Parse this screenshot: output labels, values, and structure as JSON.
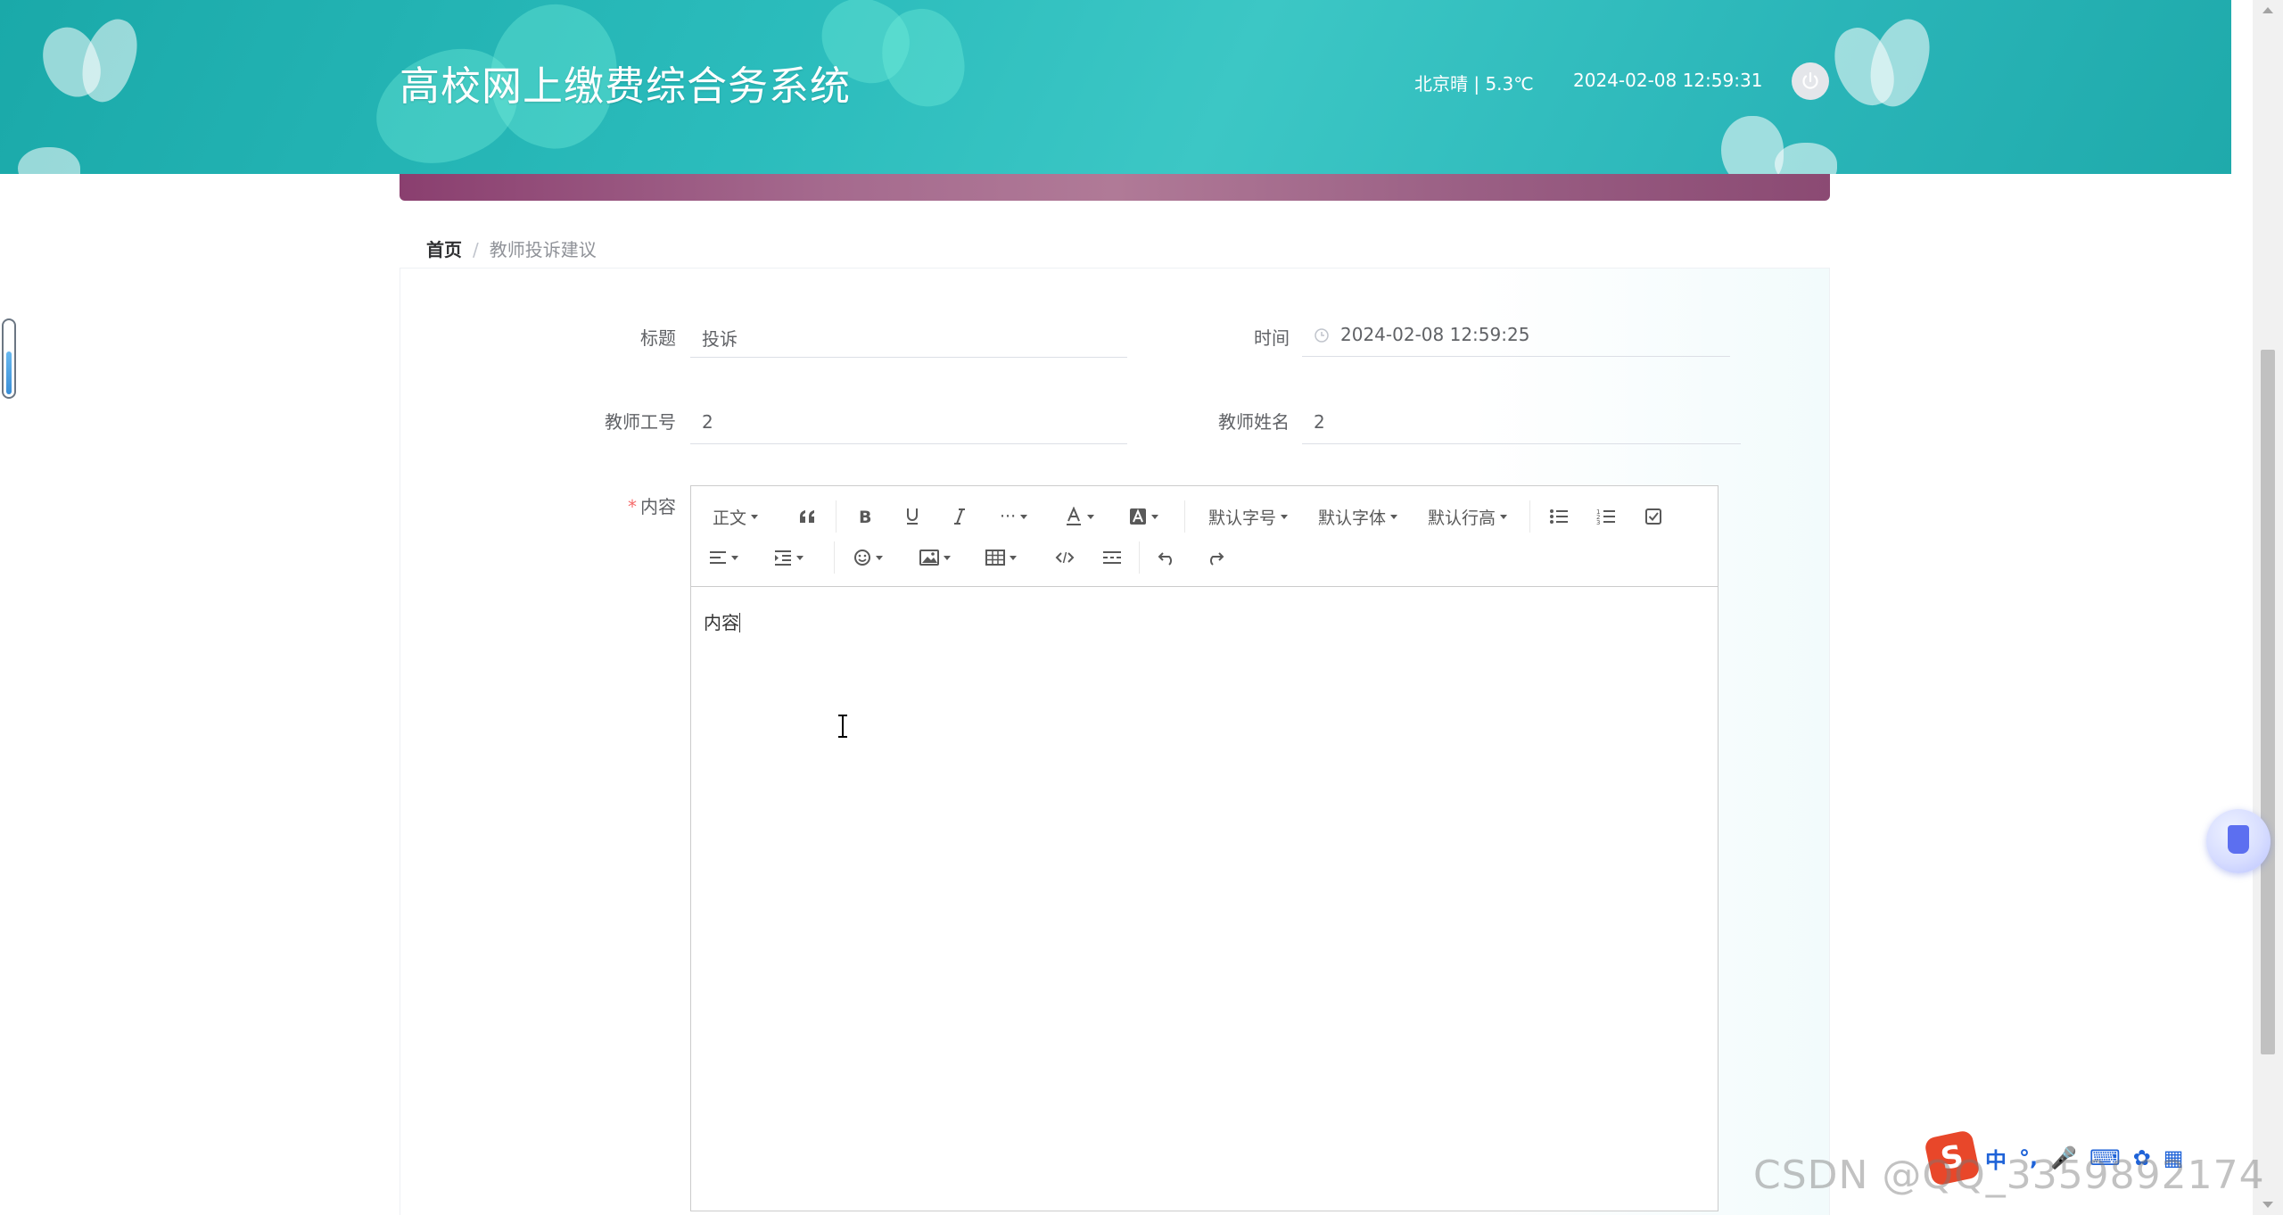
{
  "header": {
    "title": "高校网上缴费综合务系统",
    "weather": "北京晴 | 5.3℃",
    "datetime": "2024-02-08   12:59:31"
  },
  "breadcrumb": {
    "home": "首页",
    "separator": "/",
    "current": "教师投诉建议"
  },
  "form": {
    "title_label": "标题",
    "title_value": "投诉",
    "time_label": "时间",
    "time_value": "2024-02-08 12:59:25",
    "teacher_id_label": "教师工号",
    "teacher_id_value": "2",
    "teacher_name_label": "教师姓名",
    "teacher_name_value": "2",
    "content_required_mark": "*",
    "content_label": "内容"
  },
  "editor": {
    "toolbar": {
      "heading": "正文",
      "font_size": "默认字号",
      "font_family": "默认字体",
      "line_height": "默认行高",
      "more": "···"
    },
    "content": "内容"
  },
  "ime": {
    "logo": "S",
    "mode": "中"
  },
  "watermark": "CSDN @QQ_3359892174",
  "colors": {
    "header": "#2bbcbc",
    "banner": "#a56a8e",
    "required": "#f56c6c"
  }
}
